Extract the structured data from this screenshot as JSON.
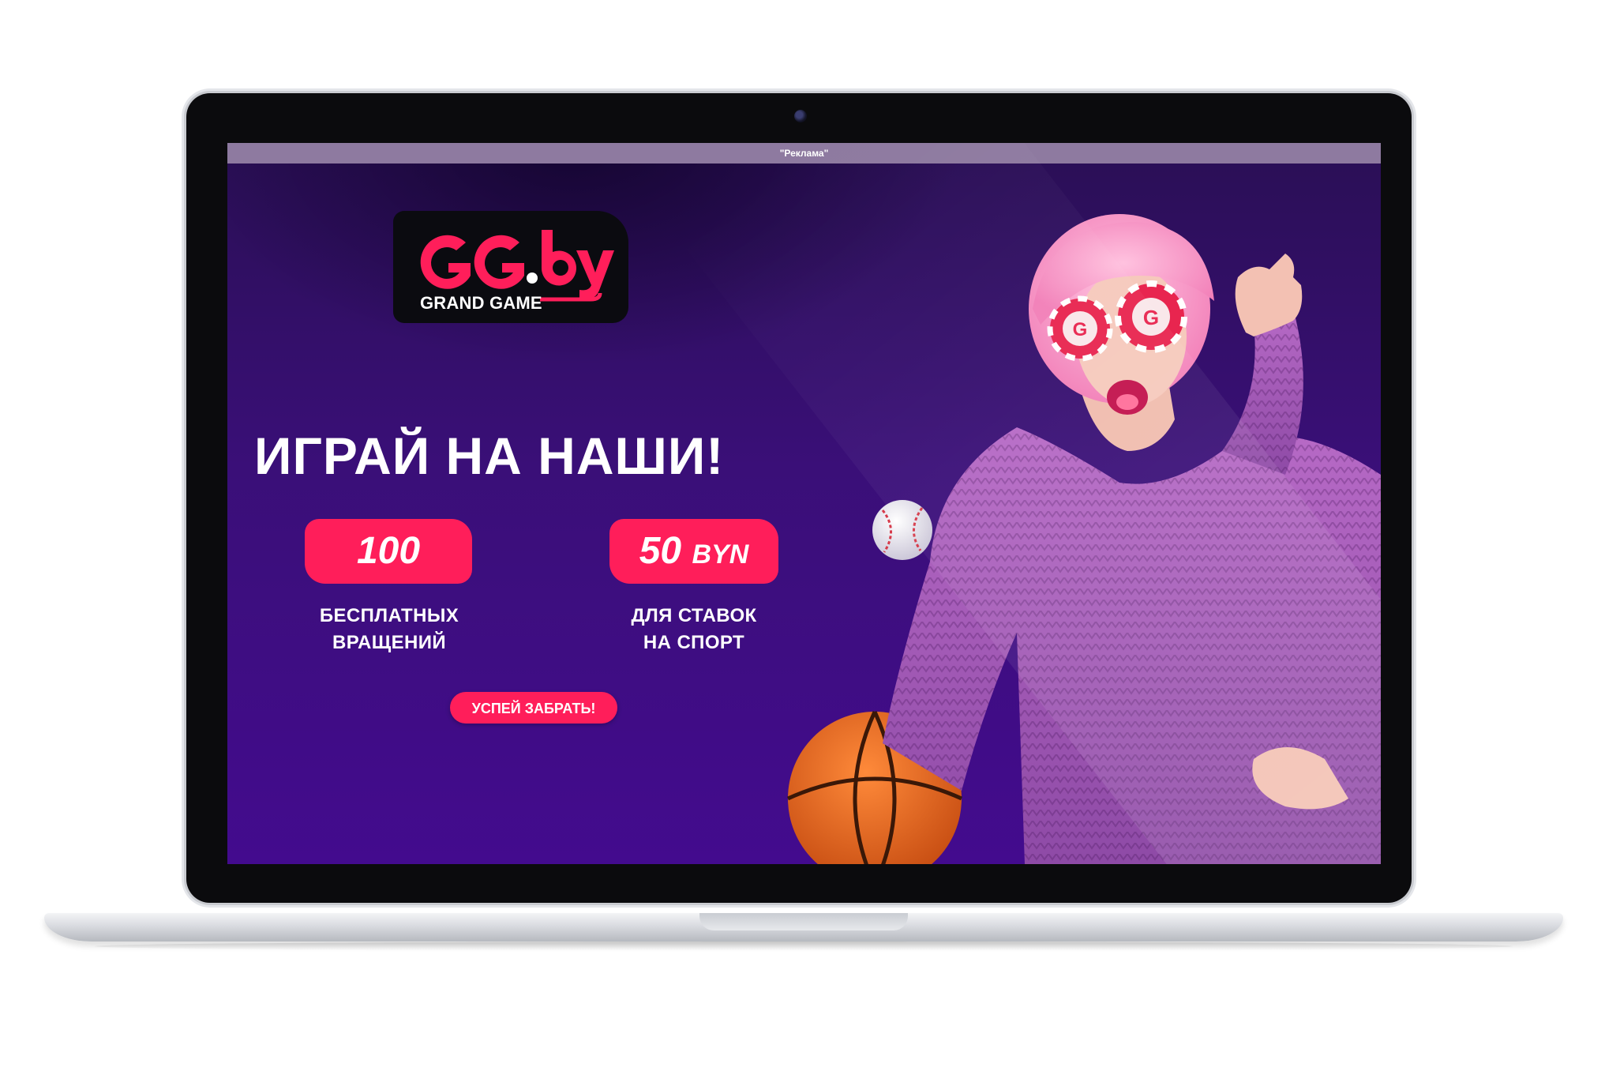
{
  "ad_bar": {
    "text": "\"Реклама\""
  },
  "logo": {
    "mark": "GG.by",
    "tagline": "GRAND GAME"
  },
  "promo": {
    "headline": "ИГРАЙ НА НАШИ!",
    "offers": [
      {
        "value": "100",
        "unit": "",
        "label_line1": "БЕСПЛАТНЫХ",
        "label_line2": "ВРАЩЕНИЙ"
      },
      {
        "value": "50",
        "unit": "BYN",
        "label_line1": "ДЛЯ СТАВОК",
        "label_line2": "НА СПОРТ"
      }
    ],
    "cta_label": "УСПЕЙ ЗАБРАТЬ!"
  },
  "colors": {
    "accent": "#ff1e5a",
    "background_top": "#2a0f55",
    "background_bottom": "#430b8e",
    "ad_bar": "#8e7aa0"
  },
  "icons": [
    "baseball-icon",
    "basketball-icon",
    "casino-chip-icon"
  ]
}
